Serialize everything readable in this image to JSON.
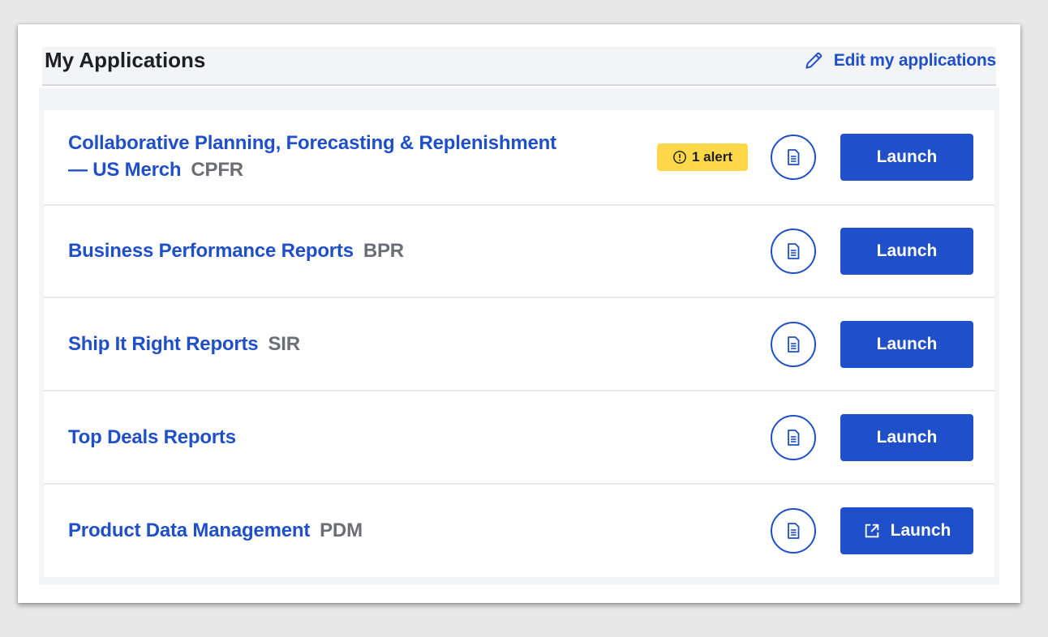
{
  "header": {
    "title": "My Applications",
    "edit_label": "Edit my applications",
    "edit_icon": "pencil-icon"
  },
  "colors": {
    "accent": "#1f4fc9",
    "alert": "#ffd84a",
    "abbr": "#6b6e74"
  },
  "applications": [
    {
      "name_line1": "Collaborative Planning, Forecasting & Replenishment",
      "name_line2": "— US Merch",
      "abbr": "CPFR",
      "alert": "1 alert",
      "doc_icon": "document-icon",
      "launch_label": "Launch"
    },
    {
      "name": "Business Performance Reports",
      "abbr": "BPR",
      "doc_icon": "document-icon",
      "launch_label": "Launch"
    },
    {
      "name": "Ship It Right Reports",
      "abbr": "SIR",
      "doc_icon": "document-icon",
      "launch_label": "Launch"
    },
    {
      "name": "Top Deals Reports",
      "abbr": "",
      "doc_icon": "document-icon",
      "launch_label": "Launch"
    },
    {
      "name": "Product Data Management",
      "abbr": "PDM",
      "doc_icon": "document-icon",
      "launch_label": "Launch",
      "launch_icon": "external-link-icon"
    }
  ]
}
